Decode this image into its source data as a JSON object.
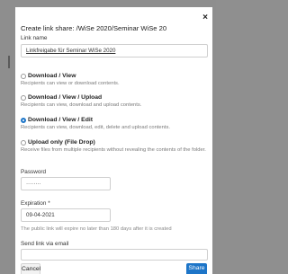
{
  "dialog": {
    "title": "Create link share: /WiSe 2020/Seminar WiSe 20",
    "close_symbol": "×"
  },
  "link_name": {
    "label": "Link name",
    "value": "Linkfreigabe für Seminar WiSe 2020"
  },
  "permissions": [
    {
      "title": "Download / View",
      "description": "Recipients can view or download contents.",
      "checked": false
    },
    {
      "title": "Download / View / Upload",
      "description": "Recipients can view, download and upload contents.",
      "checked": false
    },
    {
      "title": "Download / View / Edit",
      "description": "Recipients can view, download, edit, delete and upload contents.",
      "checked": true
    },
    {
      "title": "Upload only (File Drop)",
      "description": "Receive files from multiple recipients without revealing the contents of the folder.",
      "checked": false
    }
  ],
  "password": {
    "label": "Password",
    "value": "········"
  },
  "expiration": {
    "label": "Expiration *",
    "value": "09-04-2021",
    "hint": "The public link will expire no later than 180 days after it is created"
  },
  "email": {
    "label": "Send link via email",
    "value": ""
  },
  "buttons": {
    "cancel": "Cancel",
    "share": "Share"
  },
  "colors": {
    "accent": "#1d75c8",
    "backdrop": "#8f8f8f"
  }
}
